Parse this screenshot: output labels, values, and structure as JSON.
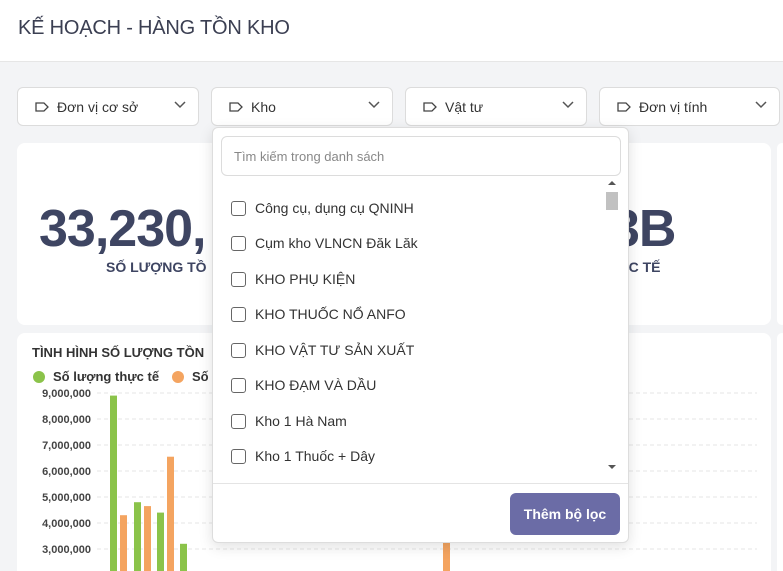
{
  "page": {
    "title": "KẾ HOẠCH - HÀNG TỒN KHO"
  },
  "filters": [
    {
      "label": "Đơn vị cơ sở"
    },
    {
      "label": "Kho"
    },
    {
      "label": "Vật tư"
    },
    {
      "label": "Đơn vị tính"
    }
  ],
  "kpi": {
    "left_value": "33,230,",
    "left_label": "SỐ LƯỢNG TỒ",
    "right_value": "3B",
    "right_label": "ỰC TẾ"
  },
  "chart": {
    "title": "TÌNH HÌNH SỐ LƯỢNG TỒN",
    "legend": [
      {
        "label": "Số lượng thực tế",
        "color": "#8bc34a"
      },
      {
        "label": "Số",
        "color": "#f4a460"
      }
    ]
  },
  "chart_data": {
    "type": "bar",
    "title": "TÌNH HÌNH SỐ LƯỢNG TỒN",
    "y_ticks": [
      "9,000,000",
      "8,000,000",
      "7,000,000",
      "6,000,000",
      "5,000,000",
      "4,000,000",
      "3,000,000"
    ],
    "ylim": [
      2500000,
      9500000
    ],
    "grid": true,
    "legend_position": "top-left",
    "series": [
      {
        "name": "Số lượng thực tế",
        "color": "#8bc34a",
        "values": [
          8900000,
          4800000,
          4400000,
          3200000
        ]
      },
      {
        "name": "Số",
        "color": "#f4a460",
        "values": [
          4300000,
          4650000,
          6550000
        ]
      }
    ],
    "extra_series_b_value": 3800000
  },
  "dropdown": {
    "search_placeholder": "Tìm kiếm trong danh sách",
    "options": [
      "Công cụ, dụng cụ QNINH",
      "Cụm kho VLNCN Đăk Lăk",
      "KHO PHỤ KIỆN",
      "KHO THUỐC NỔ ANFO",
      "KHO VẬT TƯ SẢN XUẤT",
      "KHO ĐẠM VÀ DẦU",
      "Kho 1 Hà Nam",
      "Kho 1 Thuốc + Dây"
    ],
    "apply_label": "Thêm bộ lọc"
  }
}
